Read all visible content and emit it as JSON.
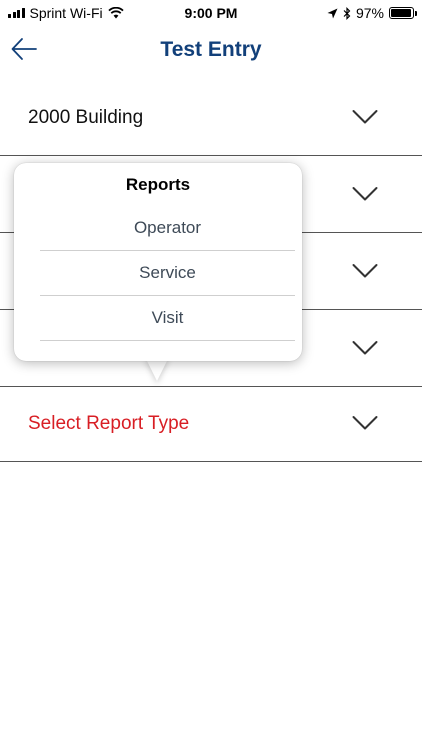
{
  "status_bar": {
    "carrier": "Sprint Wi-Fi",
    "time": "9:00 PM",
    "battery_percent": "97%",
    "battery_level": 0.97
  },
  "nav": {
    "title": "Test Entry",
    "back_icon": "arrow-left-icon",
    "accent_color": "#12407a"
  },
  "form": {
    "rows": [
      {
        "label": "2000 Building"
      },
      {
        "label": ""
      },
      {
        "label": ""
      },
      {
        "label": ""
      },
      {
        "label": "Select Report Type",
        "placeholder_color": "#d81e24"
      }
    ]
  },
  "popover": {
    "title": "Reports",
    "options": [
      "Operator",
      "Service",
      "Visit"
    ]
  }
}
